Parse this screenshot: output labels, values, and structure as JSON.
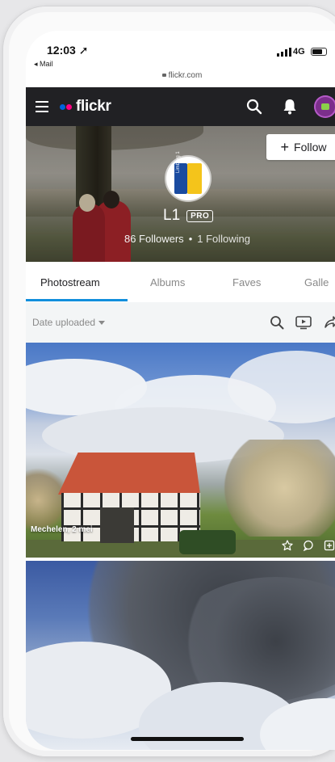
{
  "status_bar": {
    "time": "12:03",
    "back_app": "◂ Mail",
    "network": "4G",
    "url": "flickr.com"
  },
  "nav": {
    "logo_text": "flickr",
    "brand_colors": {
      "blue": "#0063dc",
      "pink": "#ff0084"
    },
    "bar_color": "#212124",
    "icons": [
      "menu-icon",
      "search-icon",
      "bell-icon",
      "avatar"
    ]
  },
  "profile": {
    "name": "L1",
    "pro_badge": "PRO",
    "followers": "86 Followers",
    "following": "1 Following",
    "separator": "•",
    "follow_label": "Follow",
    "follow_plus": "+",
    "avatar_text": "Limburg 1"
  },
  "tabs": {
    "items": [
      {
        "label": "Photostream"
      },
      {
        "label": "Albums"
      },
      {
        "label": "Faves"
      },
      {
        "label": "Galle"
      }
    ],
    "accent": "#128fdc"
  },
  "filter": {
    "sort_label": "Date uploaded",
    "icons": [
      "search-icon",
      "slideshow-icon",
      "share-icon"
    ]
  },
  "photos": [
    {
      "title": "Mechelen, 2 mei",
      "icons": [
        "star-icon",
        "comment-icon",
        "add-to-gallery-icon"
      ]
    },
    {
      "title": ""
    }
  ]
}
